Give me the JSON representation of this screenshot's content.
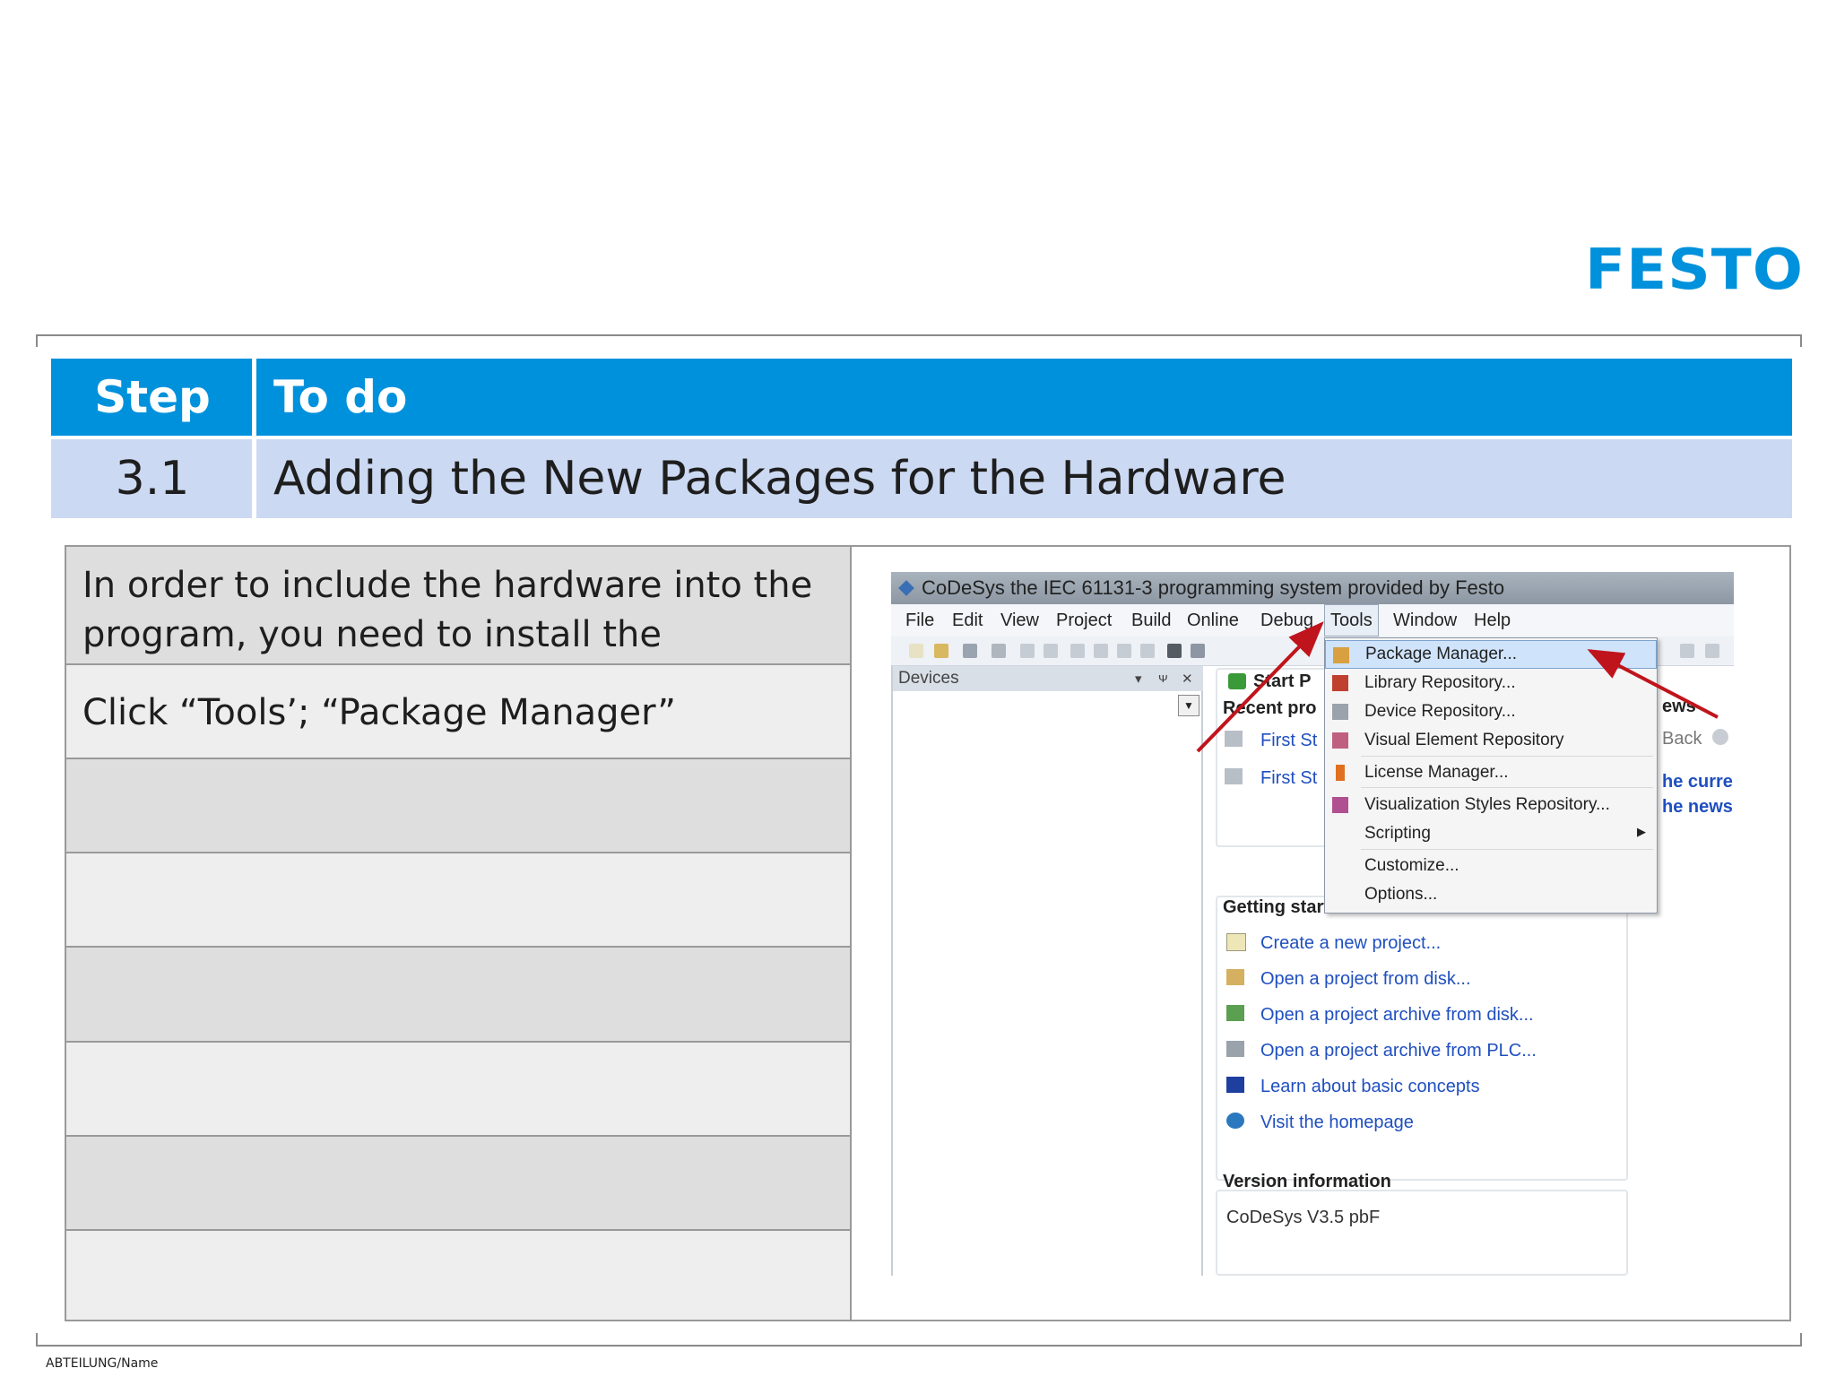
{
  "logo": {
    "text": "FESTO",
    "color": "#0091dc"
  },
  "header": {
    "step_label": "Step",
    "todo_label": "To do",
    "color": "#0091dc"
  },
  "step": {
    "number": "3.1",
    "title": "Adding the New Packages for the Hardware"
  },
  "instructions": [
    "In order to include the hardware into the program, you need to install the package.",
    "Click “Tools’; “Package Manager”",
    "",
    "",
    "",
    "",
    "",
    ""
  ],
  "screenshot": {
    "window_title": "CoDeSys the IEC 61131-3 programming system provided by Festo",
    "menu": [
      "File",
      "Edit",
      "View",
      "Project",
      "Build",
      "Online",
      "Debug",
      "Tools",
      "Window",
      "Help"
    ],
    "devices_panel": {
      "title": "Devices"
    },
    "start_page": {
      "tab_label": "Start P",
      "recent_heading": "Recent pro",
      "recent_items": [
        "First St",
        "First St"
      ],
      "news_heading": "ews",
      "back_label": "Back",
      "news_lines": [
        "he curren",
        "he news i"
      ],
      "getting_started": "Getting started",
      "links": [
        "Create a new project...",
        "Open a project from disk...",
        "Open a project archive from disk...",
        "Open a project archive from PLC...",
        "Learn about basic concepts",
        "Visit the homepage"
      ],
      "version_heading": "Version information",
      "version": "CoDeSys V3.5 pbF"
    },
    "tools_menu": [
      "Package Manager...",
      "Library Repository...",
      "Device Repository...",
      "Visual Element Repository",
      "License Manager...",
      "Visualization Styles Repository...",
      "Scripting",
      "Customize...",
      "Options..."
    ],
    "arrow_color": "#c0141c"
  },
  "footer": {
    "text": "ABTEILUNG/Name"
  }
}
